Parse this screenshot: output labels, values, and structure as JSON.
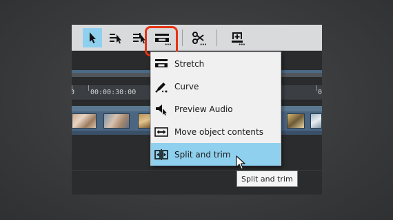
{
  "toolbar": {
    "buttons": [
      {
        "icon": "pointer-icon",
        "active": true
      },
      {
        "icon": "select-range-icon",
        "active": false
      },
      {
        "icon": "select-all-right-icon",
        "active": false
      },
      {
        "icon": "stretch-mode-icon",
        "active": false
      },
      {
        "icon": "scissors-icon",
        "active": false
      },
      {
        "icon": "insert-marker-icon",
        "active": false
      }
    ]
  },
  "timeline": {
    "timecodes": [
      "0",
      "00:00:30:00",
      "0"
    ]
  },
  "menu": {
    "items": [
      {
        "label": "Stretch",
        "icon": "stretch-icon",
        "selected": false
      },
      {
        "label": "Curve",
        "icon": "curve-pen-icon",
        "selected": false
      },
      {
        "label": "Preview Audio",
        "icon": "speaker-icon",
        "selected": false
      },
      {
        "label": "Move object contents",
        "icon": "move-contents-icon",
        "selected": false
      },
      {
        "label": "Split and trim",
        "icon": "split-trim-icon",
        "selected": true
      }
    ]
  },
  "tooltip": {
    "text": "Split and trim"
  },
  "colors": {
    "accent_highlight": "#e63312",
    "selection": "#8fd0ee"
  }
}
